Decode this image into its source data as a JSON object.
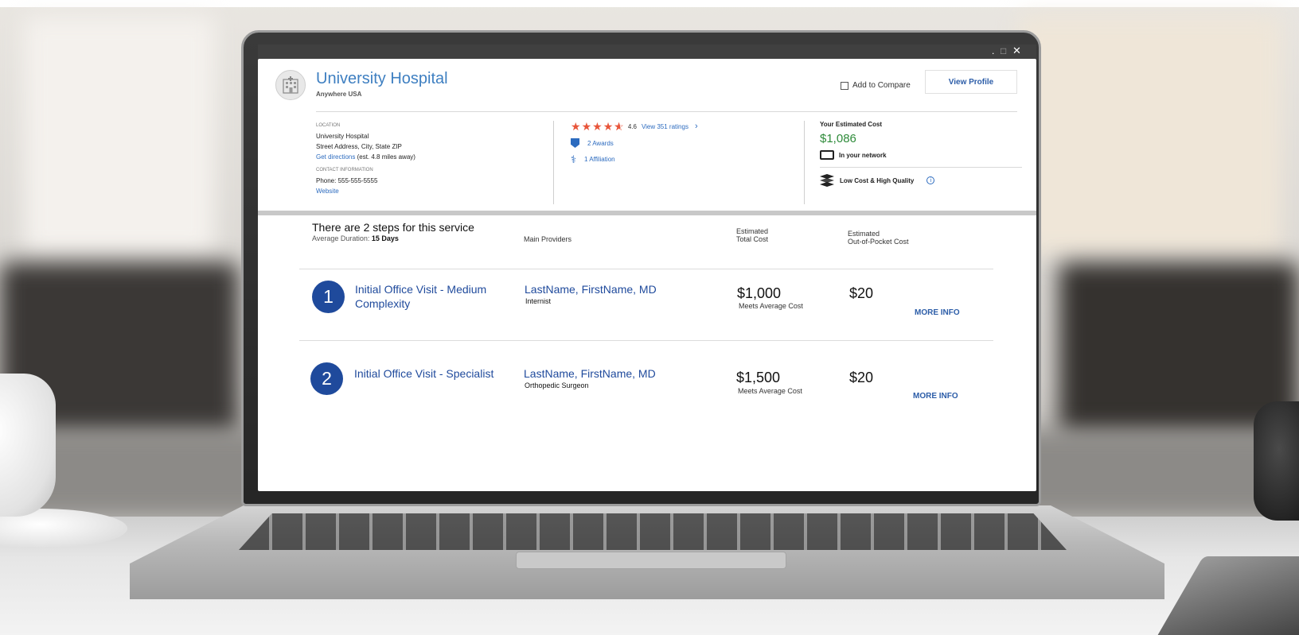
{
  "window": {
    "minimize_glyph": ".",
    "maximize_glyph": "□",
    "close_glyph": "✕"
  },
  "hospital": {
    "name": "University Hospital",
    "region": "Anywhere USA",
    "compare_label": "Add to Compare",
    "view_profile_label": "View Profile"
  },
  "location": {
    "section_label": "LOCATION",
    "name": "University Hospital",
    "address": "Street Address, City, State ZIP",
    "directions_link": "Get directions",
    "distance": "(est. 4.8 miles away)",
    "contact_label": "CONTACT INFORMATION",
    "phone": "Phone: 555-555-5555",
    "website_link": "Website"
  },
  "ratings": {
    "score": "4.6",
    "stars_value": 4.6,
    "stars_max": 5,
    "view_ratings_link": "View 351 ratings",
    "awards_link": "2 Awards",
    "affiliation_link": "1 Affiliation",
    "accent_color": "#e8553a"
  },
  "estimate": {
    "label": "Your Estimated Cost",
    "amount": "$1,086",
    "amount_color": "#2e8b3a",
    "network_label": "In your network",
    "quality_label": "Low Cost & High Quality"
  },
  "steps": {
    "title": "There are 2 steps for this service",
    "duration_label": "Average Duration: ",
    "duration_value": "15 Days",
    "headers": {
      "providers": "Main Providers",
      "total_cost_line1": "Estimated",
      "total_cost_line2": "Total Cost",
      "oop_line1": "Estimated",
      "oop_line2": "Out-of-Pocket Cost"
    },
    "items": [
      {
        "number": "1",
        "name": "Initial Office Visit - Medium Complexity",
        "provider": "LastName, FirstName, MD",
        "specialty": "Internist",
        "total_cost": "$1,000",
        "cost_note": "Meets Average Cost",
        "oop_cost": "$20",
        "more_info": "MORE INFO"
      },
      {
        "number": "2",
        "name": "Initial Office Visit - Specialist",
        "provider": "LastName, FirstName, MD",
        "specialty": "Orthopedic Surgeon",
        "total_cost": "$1,500",
        "cost_note": "Meets Average Cost",
        "oop_cost": "$20",
        "more_info": "MORE INFO"
      }
    ],
    "brand_color": "#1f4a9c"
  }
}
